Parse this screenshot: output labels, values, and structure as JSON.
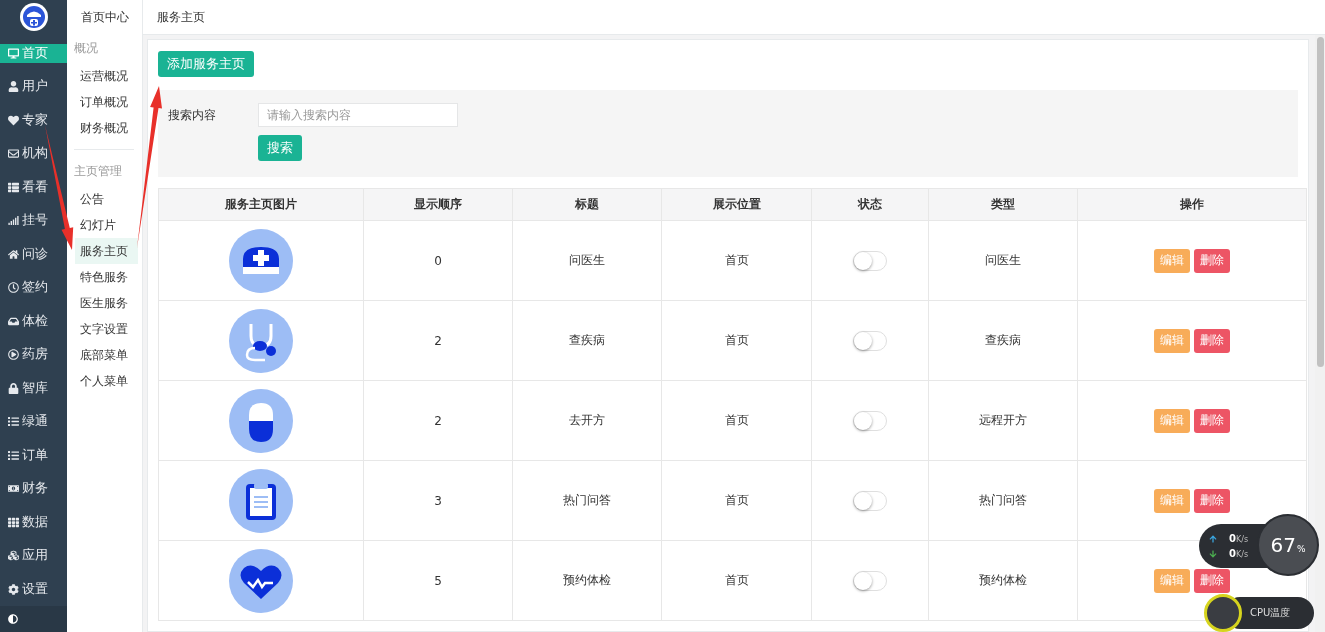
{
  "sidebar": {
    "items": [
      {
        "label": "首页",
        "selected": true
      },
      {
        "label": "用户",
        "selected": false
      },
      {
        "label": "专家",
        "selected": false
      },
      {
        "label": "机构",
        "selected": false
      },
      {
        "label": "看看",
        "selected": false
      },
      {
        "label": "挂号",
        "selected": false
      },
      {
        "label": "问诊",
        "selected": false
      },
      {
        "label": "签约",
        "selected": false
      },
      {
        "label": "体检",
        "selected": false
      },
      {
        "label": "药房",
        "selected": false
      },
      {
        "label": "智库",
        "selected": false
      },
      {
        "label": "绿通",
        "selected": false
      },
      {
        "label": "订单",
        "selected": false
      },
      {
        "label": "财务",
        "selected": false
      },
      {
        "label": "数据",
        "selected": false
      },
      {
        "label": "应用",
        "selected": false
      },
      {
        "label": "设置",
        "selected": false
      }
    ]
  },
  "subnav": {
    "title": "首页中心",
    "sections": [
      {
        "heading": "概况",
        "items": [
          {
            "label": "运营概况",
            "selected": false
          },
          {
            "label": "订单概况",
            "selected": false
          },
          {
            "label": "财务概况",
            "selected": false
          }
        ]
      },
      {
        "heading": "主页管理",
        "items": [
          {
            "label": "公告",
            "selected": false
          },
          {
            "label": "幻灯片",
            "selected": false
          },
          {
            "label": "服务主页",
            "selected": true
          },
          {
            "label": "特色服务",
            "selected": false
          },
          {
            "label": "医生服务",
            "selected": false
          },
          {
            "label": "文字设置",
            "selected": false
          },
          {
            "label": "底部菜单",
            "selected": false
          },
          {
            "label": "个人菜单",
            "selected": false
          }
        ]
      }
    ]
  },
  "breadcrumb": "服务主页",
  "add_button": "添加服务主页",
  "search": {
    "label": "搜索内容",
    "placeholder": "请输入搜索内容",
    "button": "搜索"
  },
  "table": {
    "columns": [
      "服务主页图片",
      "显示顺序",
      "标题",
      "展示位置",
      "状态",
      "类型",
      "操作"
    ],
    "rows": [
      {
        "order": "0",
        "title": "问医生",
        "position": "首页",
        "on": false,
        "type": "问医生",
        "actions": [
          "编辑",
          "删除"
        ]
      },
      {
        "order": "2",
        "title": "查疾病",
        "position": "首页",
        "on": false,
        "type": "查疾病",
        "actions": [
          "编辑",
          "删除"
        ]
      },
      {
        "order": "2",
        "title": "去开方",
        "position": "首页",
        "on": false,
        "type": "远程开方",
        "actions": [
          "编辑",
          "删除"
        ]
      },
      {
        "order": "3",
        "title": "热门问答",
        "position": "首页",
        "on": false,
        "type": "热门问答",
        "actions": [
          "编辑",
          "删除"
        ]
      },
      {
        "order": "5",
        "title": "预约体检",
        "position": "首页",
        "on": false,
        "type": "预约体检",
        "actions": [
          "编辑",
          "删除"
        ]
      }
    ]
  },
  "net_monitor": {
    "upload": {
      "value": "0",
      "unit": "K/s"
    },
    "download": {
      "value": "0",
      "unit": "K/s"
    },
    "percent": "67",
    "percent_sign": "%",
    "cpu_label": "CPU温度"
  },
  "annotations": [
    {
      "kind": "arrow"
    },
    {
      "kind": "arrow"
    }
  ]
}
